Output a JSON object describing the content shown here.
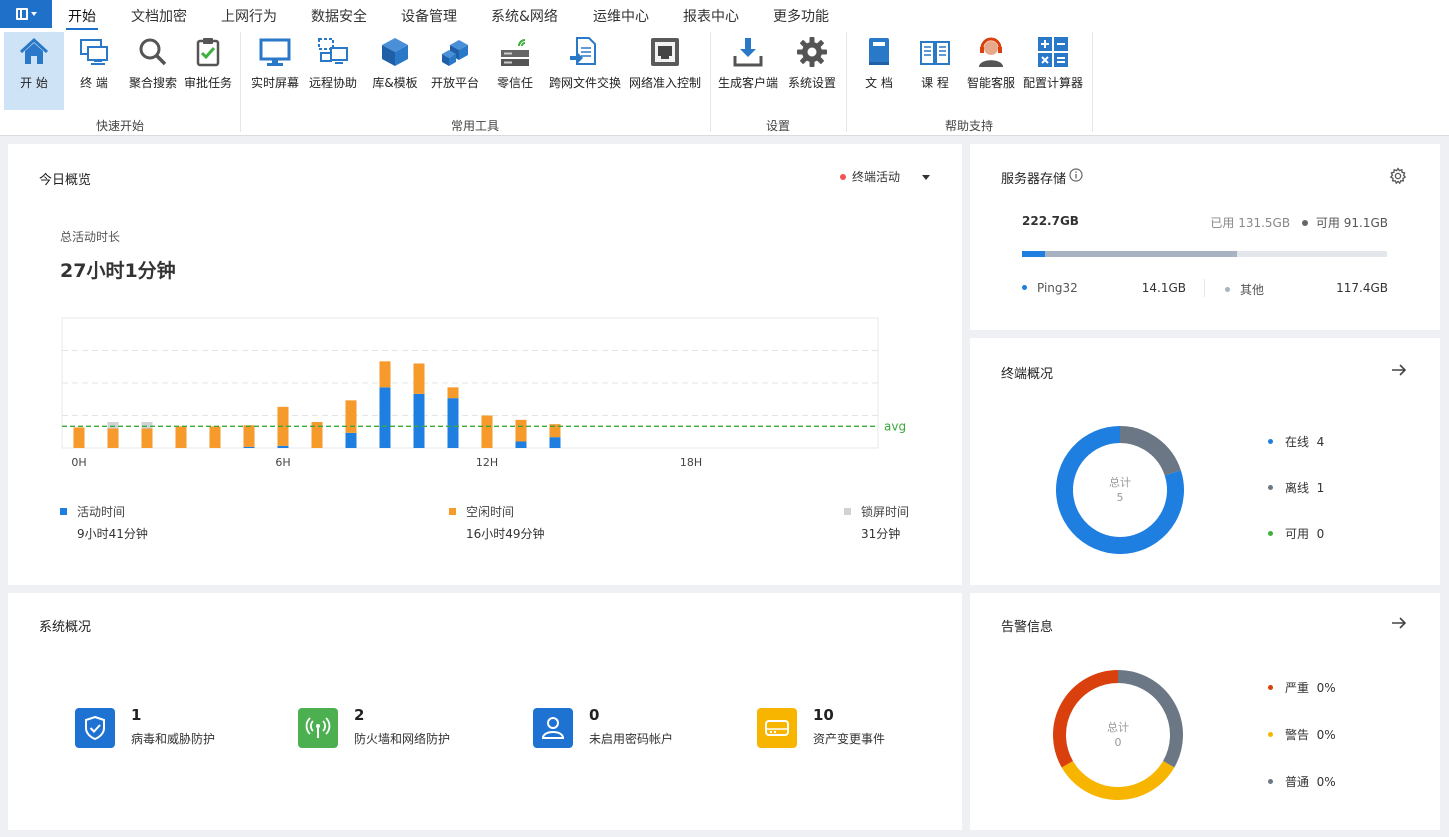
{
  "menu": {
    "items": [
      "开始",
      "文档加密",
      "上网行为",
      "数据安全",
      "设备管理",
      "系统&网络",
      "运维中心",
      "报表中心",
      "更多功能"
    ]
  },
  "ribbon": {
    "groups": {
      "quick": "快速开始",
      "tools": "常用工具",
      "settings": "设置",
      "help": "帮助支持"
    },
    "buttons": [
      "开 始",
      "终 端",
      "聚合搜索",
      "审批任务",
      "实时屏幕",
      "远程协助",
      "库&模板",
      "开放平台",
      "零信任",
      "跨网文件交换",
      "网络准入控制",
      "生成客户端",
      "系统设置",
      "文 档",
      "课 程",
      "智能客服",
      "配置计算器"
    ]
  },
  "overview": {
    "title": "今日概览",
    "filter_label": "终端活动",
    "total_label": "总活动时长",
    "total_value": "27小时1分钟",
    "avg_label": "avg",
    "legend": [
      {
        "label": "活动时间",
        "value": "9小时41分钟",
        "color": "#1e7fe0"
      },
      {
        "label": "空闲时间",
        "value": "16小时49分钟",
        "color": "#f59a2b"
      },
      {
        "label": "锁屏时间",
        "value": "31分钟",
        "color": "#cfd3d8"
      }
    ]
  },
  "chart_data": {
    "type": "bar",
    "stacked": true,
    "x_tick_labels": [
      "0H",
      "6H",
      "12H",
      "18H"
    ],
    "categories": [
      0,
      1,
      2,
      3,
      4,
      5,
      6,
      7,
      8,
      9,
      10,
      11,
      12,
      13,
      14,
      15,
      16,
      17,
      18,
      19,
      20,
      21,
      22,
      23
    ],
    "series": [
      {
        "name": "活动时间",
        "color": "#1e7fe0",
        "values": [
          0,
          0,
          0,
          0,
          0,
          0.5,
          1,
          0,
          7,
          28,
          25,
          23,
          0,
          3,
          5,
          0,
          0,
          0,
          0,
          0,
          0,
          0,
          0,
          0
        ]
      },
      {
        "name": "空闲时间",
        "color": "#f59a2b",
        "values": [
          9.5,
          9,
          9,
          10,
          10,
          10,
          18,
          12,
          15,
          12,
          14,
          5,
          15,
          10,
          6,
          0,
          0,
          0,
          0,
          0,
          0,
          0,
          0,
          0
        ]
      },
      {
        "name": "锁屏时间",
        "color": "#cfd3d8",
        "values": [
          0,
          3,
          3,
          0,
          0,
          0,
          0,
          0,
          0,
          0,
          0,
          0,
          0,
          0,
          0,
          0,
          0,
          0,
          0,
          0,
          0,
          0,
          0,
          0
        ]
      }
    ],
    "avg": 10,
    "ylim": [
      0,
      60
    ],
    "grid": true
  },
  "storage": {
    "title": "服务器存储",
    "total": "222.7GB",
    "used_label": "已用",
    "used": "131.5GB",
    "free_label": "可用",
    "free": "91.1GB",
    "bar": {
      "ping32_fraction": 0.063,
      "other_fraction": 0.527
    },
    "items": [
      {
        "label": "Ping32",
        "value": "14.1GB",
        "color": "#1e7fe0"
      },
      {
        "label": "其他",
        "value": "117.4GB",
        "color": "#a8b3c2"
      }
    ]
  },
  "terminals": {
    "title": "终端概况",
    "center_label": "总计",
    "center_value": "5",
    "items": [
      {
        "label": "在线",
        "count": "4",
        "value": 4,
        "color": "#1e7fe0"
      },
      {
        "label": "离线",
        "count": "1",
        "value": 1,
        "color": "#6b7785"
      },
      {
        "label": "可用",
        "count": "0",
        "value": 0,
        "color": "#3db13d"
      }
    ]
  },
  "system": {
    "title": "系统概况",
    "items": [
      {
        "count": "1",
        "label": "病毒和威胁防护",
        "color": "#1e73d2"
      },
      {
        "count": "2",
        "label": "防火墙和网络防护",
        "color": "#4caf50"
      },
      {
        "count": "0",
        "label": "未启用密码帐户",
        "color": "#1e73d2"
      },
      {
        "count": "10",
        "label": "资产变更事件",
        "color": "#f7b500"
      }
    ]
  },
  "alerts": {
    "title": "告警信息",
    "center_label": "总计",
    "center_value": "0",
    "items": [
      {
        "label": "严重",
        "pct": "0%",
        "color": "#d9400d"
      },
      {
        "label": "警告",
        "pct": "0%",
        "color": "#f7b500"
      },
      {
        "label": "普通",
        "pct": "0%",
        "color": "#6b7785"
      }
    ],
    "ring_colors": [
      "#6b7785",
      "#f7b500",
      "#d9400d"
    ]
  }
}
